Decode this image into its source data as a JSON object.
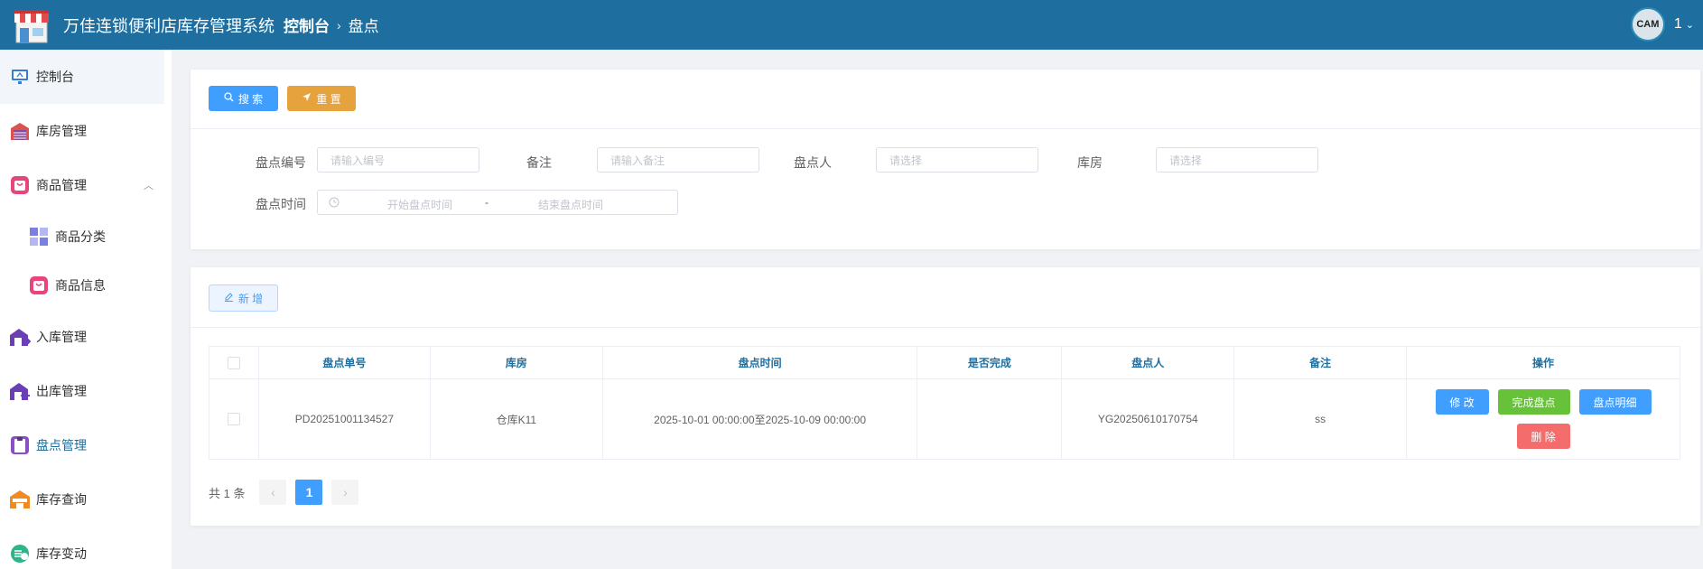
{
  "header": {
    "app_title": "万佳连锁便利店库存管理系统",
    "breadcrumb": [
      "控制台",
      "盘点"
    ],
    "avatar_text": "CAM",
    "user": "1"
  },
  "sidebar": {
    "items": [
      {
        "label": "控制台",
        "icon": "monitor-icon"
      },
      {
        "label": "库房管理",
        "icon": "warehouse-icon"
      },
      {
        "label": "商品管理",
        "icon": "bag-icon",
        "expanded": true
      },
      {
        "label": "商品分类",
        "icon": "category-icon"
      },
      {
        "label": "商品信息",
        "icon": "bag-icon"
      },
      {
        "label": "入库管理",
        "icon": "inbound-icon"
      },
      {
        "label": "出库管理",
        "icon": "outbound-icon"
      },
      {
        "label": "盘点管理",
        "icon": "clipboard-icon"
      },
      {
        "label": "库存查询",
        "icon": "store-icon"
      },
      {
        "label": "库存变动",
        "icon": "coins-icon"
      }
    ]
  },
  "search": {
    "search_label": "搜 索",
    "reset_label": "重 置",
    "fields": {
      "code": {
        "label": "盘点编号",
        "placeholder": "请输入编号"
      },
      "remark": {
        "label": "备注",
        "placeholder": "请输入备注"
      },
      "checker": {
        "label": "盘点人",
        "placeholder": "请选择"
      },
      "warehouse": {
        "label": "库房",
        "placeholder": "请选择"
      },
      "time": {
        "label": "盘点时间",
        "start_placeholder": "开始盘点时间",
        "separator": "-",
        "end_placeholder": "结束盘点时间"
      }
    }
  },
  "list": {
    "add_label": "新 增",
    "columns": [
      "盘点单号",
      "库房",
      "盘点时间",
      "是否完成",
      "盘点人",
      "备注",
      "操作"
    ],
    "rows": [
      {
        "code": "PD20251001134527",
        "warehouse": "仓库K11",
        "time": "2025-10-01 00:00:00至2025-10-09 00:00:00",
        "done": "",
        "checker": "YG20250610170754",
        "remark": "ss",
        "actions": {
          "edit": "修 改",
          "complete": "完成盘点",
          "detail": "盘点明细",
          "delete": "删 除"
        }
      }
    ],
    "pagination": {
      "total_text": "共 1 条",
      "current_page": "1",
      "prev": "‹",
      "next": "›"
    }
  },
  "colors": {
    "header_bg": "#1e6f9f",
    "primary": "#409eff",
    "warning": "#e6a23c",
    "success": "#67c23a",
    "danger": "#f56c6c"
  }
}
